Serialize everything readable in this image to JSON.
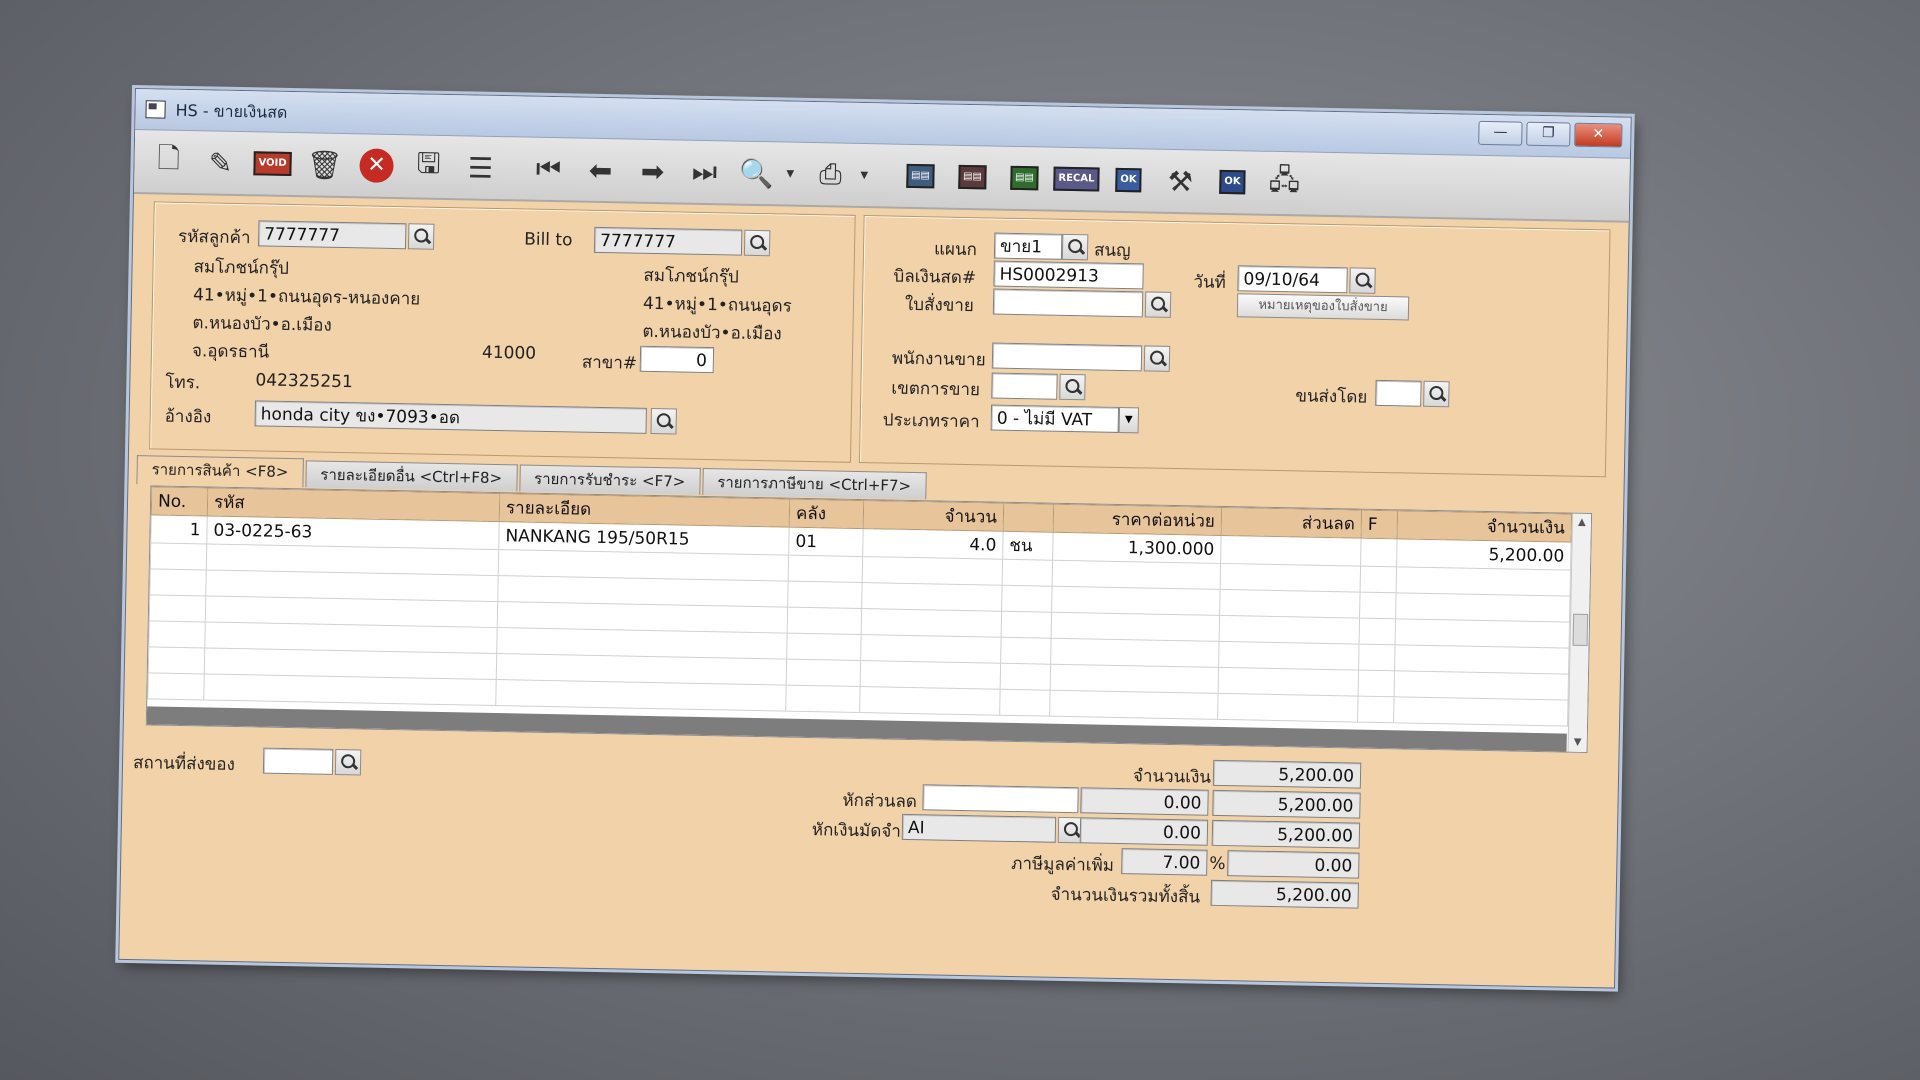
{
  "window": {
    "title": "HS - ขายเงินสด",
    "min": "—",
    "max": "❐",
    "close": "✕"
  },
  "toolbar": {
    "icons": [
      "new-icon",
      "edit-icon",
      "void-icon",
      "delete-icon",
      "cancel-icon",
      "save-icon",
      "stack-icon",
      "first-icon",
      "prev-icon",
      "next-icon",
      "last-icon",
      "search-doc-icon",
      "print-icon",
      "tool-a-icon",
      "tool-b-icon",
      "tool-c-icon",
      "recal-icon",
      "approve-icon",
      "tools-icon",
      "ok-doc-icon",
      "network-icon"
    ],
    "void_label": "VOID",
    "recal_label": "RECAL",
    "ok_label": "OK"
  },
  "customer": {
    "code_label": "รหัสลูกค้า",
    "code": "7777777",
    "billto_label": "Bill to",
    "billto": "7777777",
    "name": "สมโภชน์กรุ๊ป",
    "addr1": "41•หมู่•1•ถนนอุดร-หนองคาย",
    "addr2": "ต.หนองบัว•อ.เมือง",
    "addr3": "จ.อุดรธานี",
    "zip": "41000",
    "bill_name": "สมโภชน์กรุ๊ป",
    "bill_addr1": "41•หมู่•1•ถนนอุดร",
    "bill_addr2": "ต.หนองบัว•อ.เมือง",
    "branch_label": "สาขา#",
    "branch": "0",
    "phone_label": "โทร.",
    "phone": "042325251",
    "ref_label": "อ้างอิง",
    "ref": "honda city ขง•7093•อด"
  },
  "doc": {
    "dept_label": "แผนก",
    "dept": "ขาย1",
    "dept_name": "สนญ",
    "bill_label": "บิลเงินสด#",
    "bill_no": "HS0002913",
    "date_label": "วันที่",
    "date": "09/10/64",
    "order_label": "ใบสั่งขาย",
    "order_no": "",
    "note_button": "หมายเหตุของใบสั่งขาย",
    "sales_label": "พนักงานขาย",
    "sales": "",
    "area_label": "เขตการขาย",
    "area": "",
    "ship_label": "ขนส่งโดย",
    "ship": "",
    "price_label": "ประเภทราคา",
    "price_type": "0 - ไม่มี VAT"
  },
  "tabs": [
    {
      "label": "รายการสินค้า <F8>"
    },
    {
      "label": "รายละเอียดอื่น <Ctrl+F8>"
    },
    {
      "label": "รายการรับชำระ <F7>"
    },
    {
      "label": "รายการภาษีขาย <Ctrl+F7>"
    }
  ],
  "grid": {
    "headers": [
      "No.",
      "รหัส",
      "รายละเอียด",
      "คลัง",
      "จำนวน",
      "",
      "ราคาต่อหน่วย",
      "ส่วนลด",
      "F",
      "จำนวนเงิน"
    ],
    "rows": [
      [
        "1",
        "03-0225-63",
        "NANKANG 195/50R15",
        "01",
        "4.0",
        "ชน",
        "1,300.000",
        "",
        "",
        "5,200.00"
      ]
    ]
  },
  "footer": {
    "location_label": "สถานที่ส่งของ",
    "location": "",
    "amount_label": "จำนวนเงิน",
    "amount": "5,200.00",
    "discount_label": "หักส่วนลด",
    "discount_text": "",
    "discount_val": "0.00",
    "discount_total": "5,200.00",
    "deposit_label": "หักเงินมัดจำ",
    "deposit_code": "AI",
    "deposit_val": "0.00",
    "deposit_total": "5,200.00",
    "vat_label": "ภาษีมูลค่าเพิ่ม",
    "vat_rate": "7.00",
    "vat_pct": "%",
    "vat_amount": "0.00",
    "grand_label": "จำนวนเงินรวมทั้งสิ้น",
    "grand_total": "5,200.00"
  }
}
